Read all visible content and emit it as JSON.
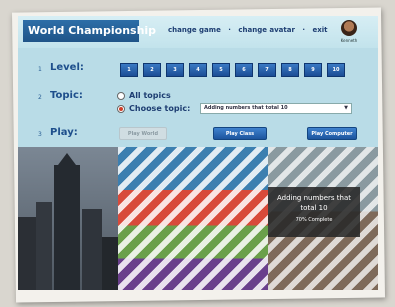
{
  "header": {
    "title": "World Championship",
    "nav": [
      "change game",
      "change avatar",
      "exit"
    ],
    "nav_separator": "·",
    "avatar_label": "Kenneth"
  },
  "rows": {
    "level": {
      "number": "1",
      "label": "Level:"
    },
    "topic": {
      "number": "2",
      "label": "Topic:"
    },
    "play": {
      "number": "3",
      "label": "Play:"
    }
  },
  "levels": [
    "1",
    "2",
    "3",
    "4",
    "5",
    "6",
    "7",
    "8",
    "9",
    "10"
  ],
  "topic_options": {
    "all": "All topics",
    "choose": "Choose topic:",
    "selected_topic": "Adding numbers that total 10",
    "selected": "choose"
  },
  "play_buttons": {
    "world": "Play World",
    "class": "Play Class",
    "computer": "Play Computer"
  },
  "media": {
    "caption": "Adding numbers that total 10",
    "status": "70% Complete"
  },
  "colors": {
    "title_bar": "#1f5488",
    "button_blue": "#1c559e",
    "background": "#b9dce7"
  }
}
